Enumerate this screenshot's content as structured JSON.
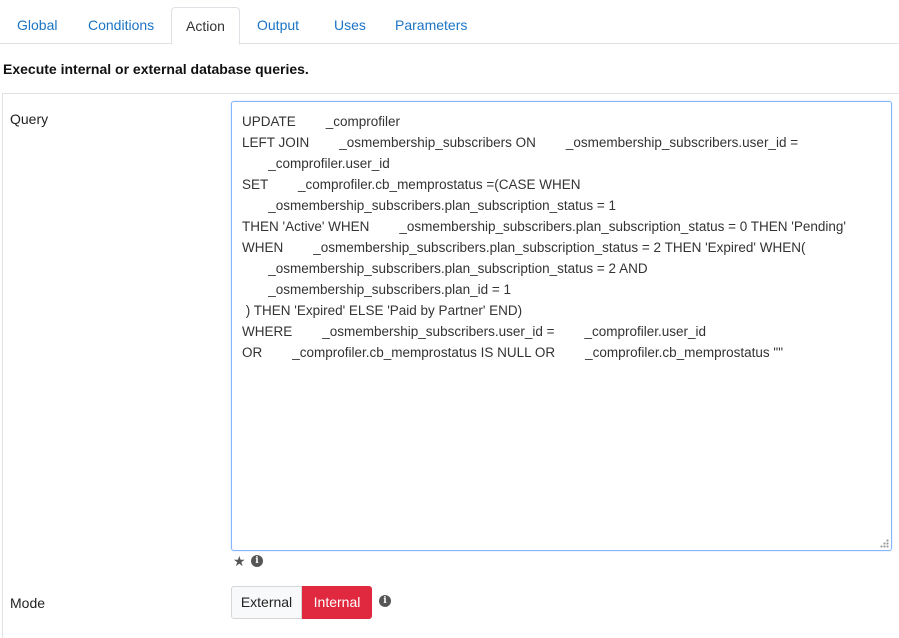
{
  "tabs": [
    {
      "label": "Global"
    },
    {
      "label": "Conditions"
    },
    {
      "label": "Action"
    },
    {
      "label": "Output"
    },
    {
      "label": "Uses"
    },
    {
      "label": "Parameters"
    }
  ],
  "active_tab": "Action",
  "description": "Execute internal or external database queries.",
  "query": {
    "label": "Query",
    "value": "UPDATE        _comprofiler\nLEFT JOIN        _osmembership_subscribers ON        _osmembership_subscribers.user_id =\n       _comprofiler.user_id\nSET        _comprofiler.cb_memprostatus =(CASE WHEN\n       _osmembership_subscribers.plan_subscription_status = 1\nTHEN 'Active' WHEN        _osmembership_subscribers.plan_subscription_status = 0 THEN 'Pending'\nWHEN        _osmembership_subscribers.plan_subscription_status = 2 THEN 'Expired' WHEN(\n       _osmembership_subscribers.plan_subscription_status = 2 AND\n       _osmembership_subscribers.plan_id = 1\n ) THEN 'Expired' ELSE 'Paid by Partner' END)\nWHERE        _osmembership_subscribers.user_id =        _comprofiler.user_id\nOR        _comprofiler.cb_memprostatus IS NULL OR        _comprofiler.cb_memprostatus \"\""
  },
  "mode": {
    "label": "Mode",
    "options": [
      "External",
      "Internal"
    ],
    "selected": "Internal"
  },
  "icons": {
    "star": "star-icon",
    "info": "info-icon"
  },
  "colors": {
    "link": "#1b74c5",
    "selected_button": "#e0283e",
    "textarea_border": "#86b7fe"
  }
}
